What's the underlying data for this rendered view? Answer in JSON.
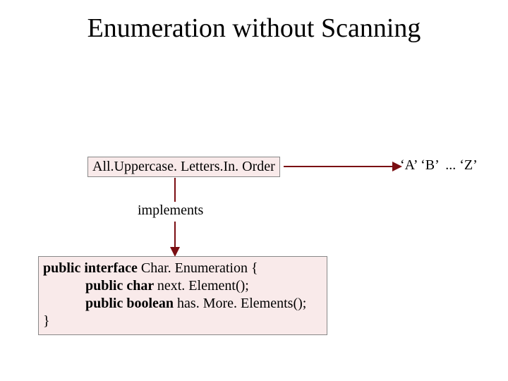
{
  "title": "Enumeration without Scanning",
  "classBox": "All.Uppercase. Letters.In. Order",
  "output": "‘A’ ‘B’  ... ‘Z’",
  "implementsLabel": "implements",
  "code": {
    "kw_public1": "public ",
    "kw_interface": "interface ",
    "iface_name": "Char. Enumeration {",
    "indent": "            ",
    "kw_public2": "public ",
    "kw_char": "char ",
    "m1": "next. Element();",
    "kw_public3": "public ",
    "kw_boolean": "boolean ",
    "m2": "has. More. Elements();",
    "close": "}"
  },
  "colors": {
    "boxFill": "#f9eaea",
    "arrow": "#7a0e12"
  }
}
